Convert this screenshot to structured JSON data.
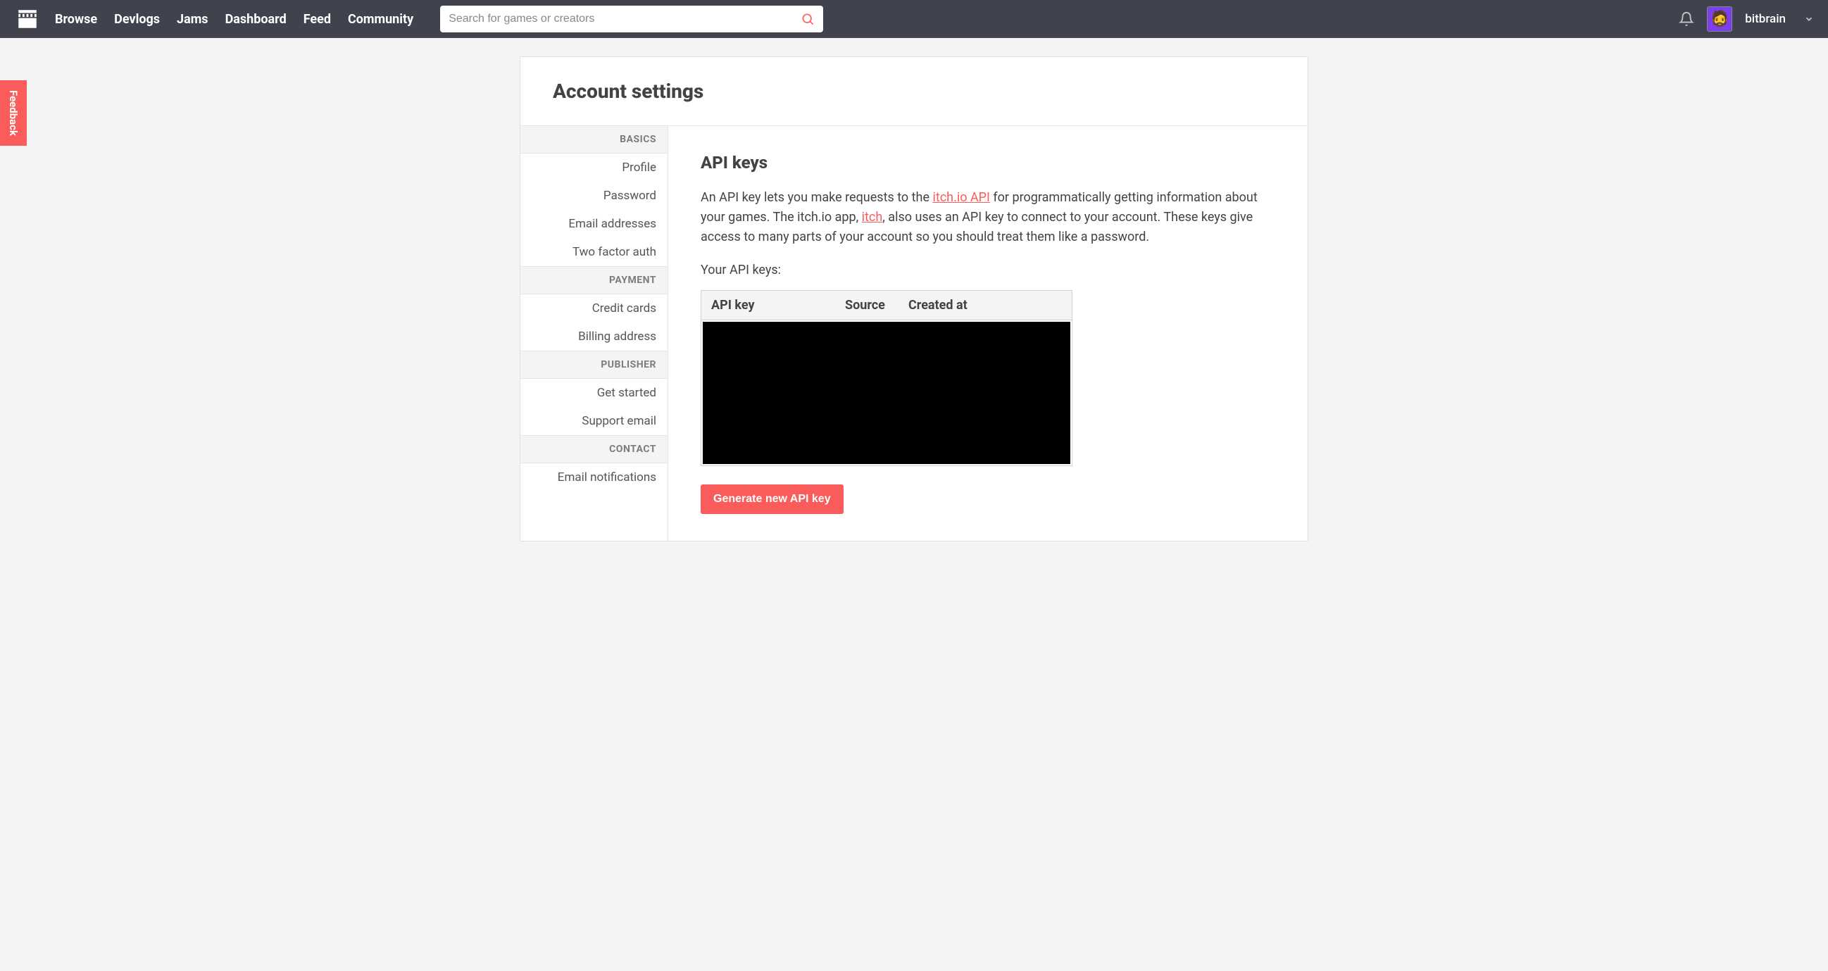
{
  "header": {
    "nav": [
      "Browse",
      "Devlogs",
      "Jams",
      "Dashboard",
      "Feed",
      "Community"
    ],
    "search_placeholder": "Search for games or creators",
    "username": "bitbrain"
  },
  "feedback_label": "Feedback",
  "page_title": "Account settings",
  "sidebar": {
    "sections": [
      {
        "header": "BASICS",
        "items": [
          "Profile",
          "Password",
          "Email addresses",
          "Two factor auth"
        ]
      },
      {
        "header": "PAYMENT",
        "items": [
          "Credit cards",
          "Billing address"
        ]
      },
      {
        "header": "PUBLISHER",
        "items": [
          "Get started",
          "Support email"
        ]
      },
      {
        "header": "CONTACT",
        "items": [
          "Email notifications"
        ]
      }
    ]
  },
  "main": {
    "heading": "API keys",
    "desc_part1": "An API key lets you make requests to the ",
    "desc_link1": "itch.io API",
    "desc_part2": " for programmatically getting information about your games. The itch.io app, ",
    "desc_link2": "itch",
    "desc_part3": ", also uses an API key to connect to your account. These keys give access to many parts of your account so you should treat them like a password.",
    "keys_label": "Your API keys:",
    "table_headers": {
      "key": "API key",
      "source": "Source",
      "created": "Created at"
    },
    "generate_button": "Generate new API key"
  }
}
